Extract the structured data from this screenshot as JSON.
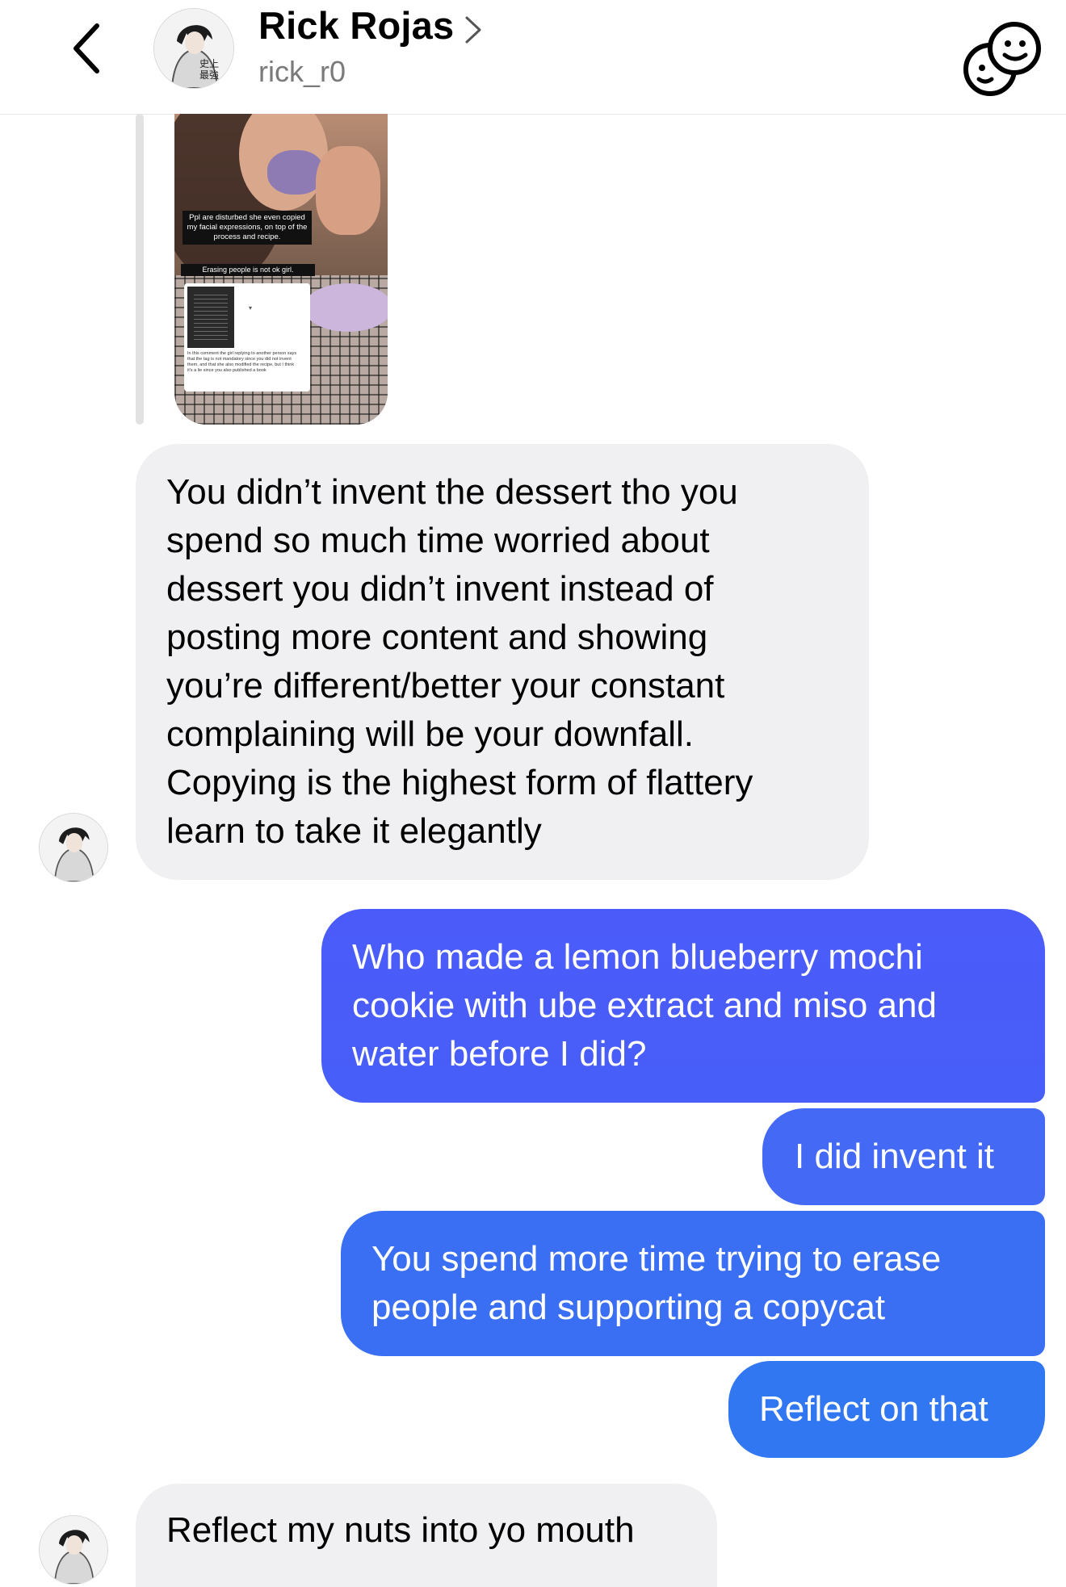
{
  "header": {
    "title": "Rick Rojas",
    "username": "rick_r0"
  },
  "shared_post": {
    "caption_top": "Ppl are disturbed she even copied my facial expressions, on top of the process and recipe.",
    "caption_bottom": "Erasing people is not ok girl.",
    "screenshot_text": "In this comment the girl replying to another person says that the tag is not mandatory since you did not invent them, and that she also modified the recipe, but I think it's a lie since you also published a book"
  },
  "messages": [
    {
      "from": "them",
      "text": "You didn’t invent the dessert tho you\nspend so much time worried about\ndessert you didn’t invent instead of\nposting more content and showing\nyou’re different/better your constant\ncomplaining will be your downfall.\nCopying is the highest form of flattery\nlearn to take it elegantly"
    },
    {
      "from": "me",
      "text": "Who made a lemon blueberry mochi\ncookie with ube extract and miso and\nwater before I did?"
    },
    {
      "from": "me",
      "text": "I did invent it"
    },
    {
      "from": "me",
      "text": "You spend more time trying to erase\npeople and supporting a copycat"
    },
    {
      "from": "me",
      "text": "Reflect on that"
    },
    {
      "from": "them",
      "text": "Reflect my nuts into yo mouth"
    }
  ],
  "colors": {
    "received_bubble": "#f0f0f2",
    "sent_gradient_top": "#5a52f6",
    "sent_gradient_bottom": "#3277f2"
  }
}
